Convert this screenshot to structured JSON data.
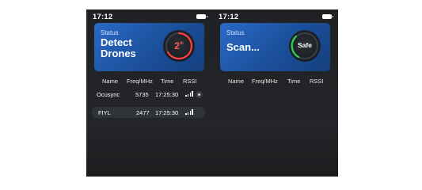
{
  "screens": [
    {
      "status_time": "17:12",
      "card": {
        "label": "Status",
        "title_line1": "Detect",
        "title_line2": "Drones",
        "gauge_value": "2",
        "gauge_unit": "th"
      },
      "columns": {
        "name": "Name",
        "freq": "Freq/MHz",
        "time": "Time",
        "rssi": "RSSI"
      },
      "rows": [
        {
          "name": "Ocusync",
          "freq": "5735",
          "time": "17:25:30"
        },
        {
          "name": "FIYL",
          "freq": "2477",
          "time": "17:25:30"
        }
      ]
    },
    {
      "status_time": "17:12",
      "card": {
        "label": "Status",
        "title": "Scan...",
        "gauge_text": "Safe"
      },
      "columns": {
        "name": "Name",
        "freq": "Freq/MHz",
        "time": "Time",
        "rssi": "RSSI"
      }
    }
  ],
  "colors": {
    "card_blue": "#1b4f9a",
    "alert_red": "#ff5a5a",
    "safe_green": "#2ecc52"
  },
  "icons": {
    "battery": "battery-icon",
    "signal": "signal-strength-icon"
  }
}
